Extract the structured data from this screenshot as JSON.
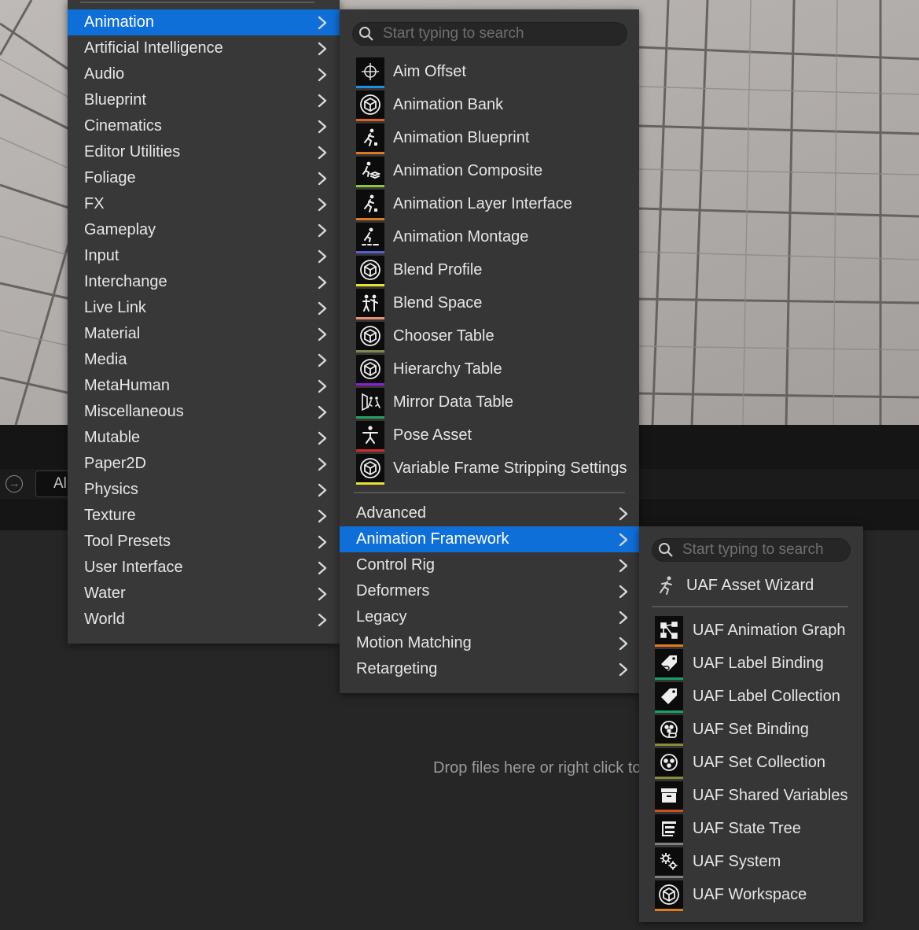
{
  "categories_menu": {
    "items": [
      {
        "label": "Animation",
        "selected": true
      },
      {
        "label": "Artificial Intelligence"
      },
      {
        "label": "Audio"
      },
      {
        "label": "Blueprint"
      },
      {
        "label": "Cinematics"
      },
      {
        "label": "Editor Utilities"
      },
      {
        "label": "Foliage"
      },
      {
        "label": "FX"
      },
      {
        "label": "Gameplay"
      },
      {
        "label": "Input"
      },
      {
        "label": "Interchange"
      },
      {
        "label": "Live Link"
      },
      {
        "label": "Material"
      },
      {
        "label": "Media"
      },
      {
        "label": "MetaHuman"
      },
      {
        "label": "Miscellaneous"
      },
      {
        "label": "Mutable"
      },
      {
        "label": "Paper2D"
      },
      {
        "label": "Physics"
      },
      {
        "label": "Texture"
      },
      {
        "label": "Tool Presets"
      },
      {
        "label": "User Interface"
      },
      {
        "label": "Water"
      },
      {
        "label": "World"
      }
    ]
  },
  "animation_menu": {
    "search_placeholder": "Start typing to search",
    "assets": [
      {
        "label": "Aim Offset",
        "icon": "crosshair-icon",
        "bar_color": "#1f8fe0"
      },
      {
        "label": "Animation Bank",
        "icon": "cube-icon",
        "bar_color": "#e06020"
      },
      {
        "label": "Animation Blueprint",
        "icon": "running-figure-icon",
        "bar_color": "#e07a20"
      },
      {
        "label": "Animation Composite",
        "icon": "running-stack-icon",
        "bar_color": "#8ec63a"
      },
      {
        "label": "Animation Layer Interface",
        "icon": "running-figure-icon",
        "bar_color": "#e07a20"
      },
      {
        "label": "Animation Montage",
        "icon": "running-track-icon",
        "bar_color": "#5560d8"
      },
      {
        "label": "Blend Profile",
        "icon": "cube-icon",
        "bar_color": "#e8e030"
      },
      {
        "label": "Blend Space",
        "icon": "blend-figures-icon",
        "bar_color": "#e89070"
      },
      {
        "label": "Chooser Table",
        "icon": "cube-icon",
        "bar_color": "#7e8a4a"
      },
      {
        "label": "Hierarchy Table",
        "icon": "cube-icon",
        "bar_color": "#8a1ed0"
      },
      {
        "label": "Mirror Data Table",
        "icon": "mirror-figures-icon",
        "bar_color": "#2aa060"
      },
      {
        "label": "Pose Asset",
        "icon": "pose-figure-icon",
        "bar_color": "#d02a2a"
      },
      {
        "label": "Variable Frame Stripping Settings",
        "icon": "cube-icon",
        "bar_color": "#e8e030"
      }
    ],
    "submenus": [
      {
        "label": "Advanced"
      },
      {
        "label": "Animation Framework",
        "selected": true
      },
      {
        "label": "Control Rig"
      },
      {
        "label": "Deformers"
      },
      {
        "label": "Legacy"
      },
      {
        "label": "Motion Matching"
      },
      {
        "label": "Retargeting"
      }
    ]
  },
  "uaf_menu": {
    "search_placeholder": "Start typing to search",
    "wizard_label": "UAF Asset Wizard",
    "assets": [
      {
        "label": "UAF Animation Graph",
        "icon": "graph-nodes-icon",
        "bar_color": "#e07a20"
      },
      {
        "label": "UAF Label Binding",
        "icon": "tag-link-icon",
        "bar_color": "#1aa060"
      },
      {
        "label": "UAF Label Collection",
        "icon": "tag-icon",
        "bar_color": "#1aa060"
      },
      {
        "label": "UAF Set Binding",
        "icon": "set-link-icon",
        "bar_color": "#8a8a3a"
      },
      {
        "label": "UAF Set Collection",
        "icon": "set-icon",
        "bar_color": "#8a8a3a"
      },
      {
        "label": "UAF Shared Variables",
        "icon": "archive-box-icon",
        "bar_color": "#d05020"
      },
      {
        "label": "UAF State Tree",
        "icon": "tree-list-icon",
        "bar_color": "#808080"
      },
      {
        "label": "UAF System",
        "icon": "gears-icon",
        "bar_color": "#808080"
      },
      {
        "label": "UAF Workspace",
        "icon": "cube-icon",
        "bar_color": "#e07a20"
      }
    ]
  },
  "content_browser": {
    "filter_text": "Al",
    "drop_hint": "Drop files here or right click to"
  },
  "colors": {
    "selection": "#0f6fd8",
    "menu_bg": "#383838"
  }
}
